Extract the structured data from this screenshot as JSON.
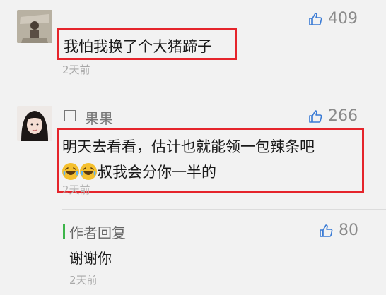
{
  "comments": [
    {
      "likes": "409",
      "text": "我怕我换了个大猪蹄子",
      "time": "2天前"
    },
    {
      "name": "果果",
      "likes": "266",
      "text_line1": "明天去看看，估计也就能领一包辣条吧",
      "text_line2": "叔我会分你一半的",
      "time": "2天前"
    }
  ],
  "reply": {
    "label": "作者回复",
    "likes": "80",
    "text": "谢谢你",
    "time": "2天前"
  },
  "icons": {
    "like": "thumbs-up-icon",
    "emoji": "laughing-tears-emoji"
  },
  "colors": {
    "highlight": "#e5242b",
    "author_bar": "#3db54a",
    "muted": "#8a8a8a"
  }
}
